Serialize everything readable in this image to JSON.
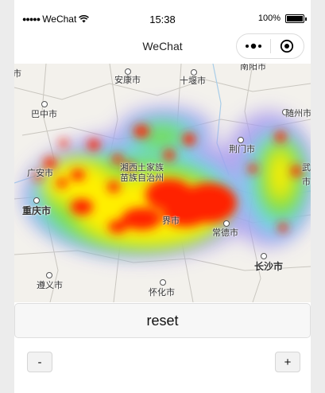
{
  "status_bar": {
    "carrier": "WeChat",
    "time": "15:38",
    "battery": "100%"
  },
  "nav": {
    "title": "WeChat"
  },
  "map": {
    "labels": {
      "ankang": "安康市",
      "shiyan": "十堰市",
      "nanyang": "南阳市",
      "bazhong": "巴中市",
      "suizhou": "随州市",
      "jingmen": "荆门市",
      "guangan": "广安市",
      "tujia": "湘西土家族",
      "tujia2": "苗族自治州",
      "chongqing": "重庆市",
      "changde": "常德市",
      "changsha": "长沙市",
      "zunyi": "遵义市",
      "huaihua": "怀化市",
      "shi_left": "市",
      "wu_right": "武",
      "shi_right": "市",
      "zhou": "州",
      "zhangjiajie": "界市"
    },
    "heat_colors": [
      "#ff2200",
      "#ffee00",
      "#77dd44",
      "#66ddee",
      "#aa99ee"
    ]
  },
  "controls": {
    "reset_label": "reset",
    "minus_label": "-",
    "plus_label": "+"
  }
}
